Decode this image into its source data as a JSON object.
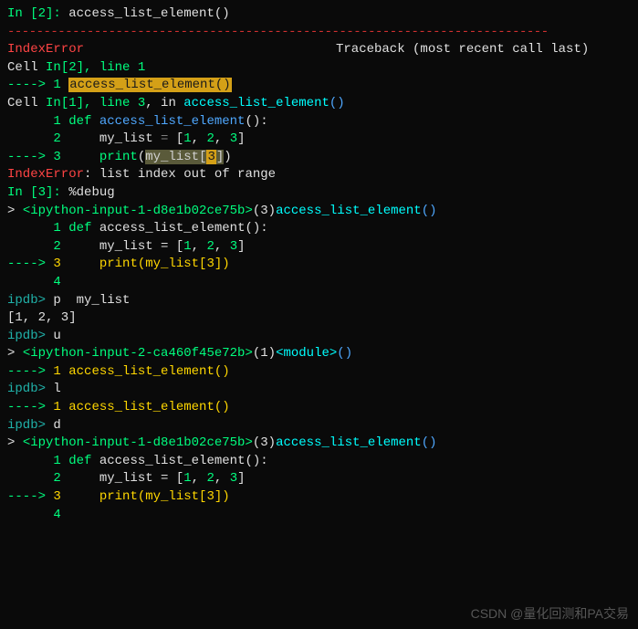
{
  "cell_in2": {
    "prompt_prefix": "In [",
    "prompt_num": "2",
    "prompt_suffix": "]: ",
    "code": "access_list_element()"
  },
  "separator": "---------------------------------------------------------------------------",
  "error_header": {
    "name": "IndexError",
    "traceback_label": "Traceback (most recent call last)"
  },
  "tb_frame1": {
    "prefix": "Cell ",
    "loc": "In[2], line 1",
    "arrow": "----> 1 ",
    "code_hl": "access_list_element()"
  },
  "tb_frame2": {
    "prefix": "Cell ",
    "loc": "In[1], line 3",
    "suffix": ", in ",
    "func": "access_list_element",
    "func_parens": "()",
    "line1_num": "      1 ",
    "line1_def": "def ",
    "line1_name": "access_list_element",
    "line1_tail": "():",
    "line2_num": "      2     ",
    "line2_a": "my_list ",
    "line2_eq": "= ",
    "line2_b1": "[",
    "line2_v1": "1",
    "line2_c": ", ",
    "line2_v2": "2",
    "line2_v3": "3",
    "line2_b2": "]",
    "line3_arrow": "----> 3     ",
    "line3_print": "print",
    "line3_op": "(",
    "line3_var": "my_list",
    "line3_br": "[",
    "line3_idx": "3",
    "line3_cl": "])"
  },
  "error_msg": {
    "name": "IndexError",
    "text": ": list index out of range"
  },
  "cell_in3": {
    "prompt_prefix": "In [",
    "prompt_num": "3",
    "prompt_suffix": "]: ",
    "code": "%debug"
  },
  "debug1": {
    "gt": "> ",
    "loc": "<ipython-input-1-d8e1b02ce75b>",
    "line": "(3)",
    "func": "access_list_element",
    "parens": "()",
    "l1n": "      1 ",
    "l1def": "def",
    "l1t": " access_list_element():",
    "l2n": "      2     ",
    "l2a": "my_list = [",
    "l2v1": "1",
    "l2c": ", ",
    "l2v2": "2",
    "l2v3": "3",
    "l2b": "]",
    "l3arrow": "----> ",
    "l3n": "3     ",
    "l3t": "print(my_list[",
    "l3idx": "3",
    "l3cl": "])",
    "l4n": "      4"
  },
  "ipdb1": {
    "prompt": "ipdb> ",
    "cmd": "p  my_list",
    "out": "[1, 2, 3]"
  },
  "ipdb2": {
    "prompt": "ipdb> ",
    "cmd": "u"
  },
  "debug2": {
    "gt": "> ",
    "loc": "<ipython-input-2-ca460f45e72b>",
    "line": "(1)",
    "func": "<module>",
    "parens": "()",
    "l1arrow": "----> ",
    "l1n": "1 ",
    "l1t": "access_list_element()"
  },
  "ipdb3": {
    "prompt": "ipdb> ",
    "cmd": "l"
  },
  "ipdb4": {
    "prompt": "ipdb> ",
    "cmd": "d"
  },
  "blank": "",
  "watermark": "CSDN @量化回测和PA交易"
}
